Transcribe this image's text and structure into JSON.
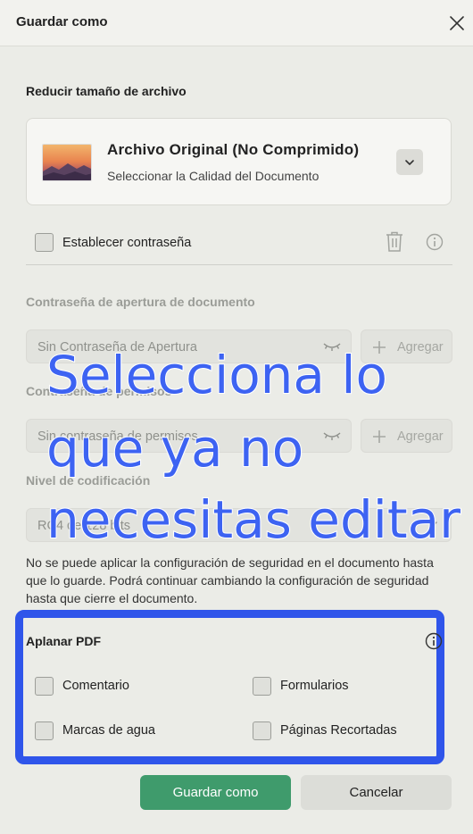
{
  "dialog": {
    "title": "Guardar como"
  },
  "reduce": {
    "label": "Reducir tamaño de archivo",
    "card_title": "Archivo Original (No Comprimido)",
    "card_subtitle": "Seleccionar la Calidad del Documento"
  },
  "password": {
    "set_label": "Establecer contraseña",
    "set_checked": false
  },
  "open_password": {
    "label": "Contraseña de apertura de documento",
    "value": "Sin Contraseña de Apertura",
    "add_label": "Agregar"
  },
  "permissions_password": {
    "label": "Contraseña de permisos",
    "value": "Sin contraseña de permisos",
    "add_label": "Agregar"
  },
  "encryption": {
    "label": "Nivel de codificación",
    "value": "RC4 de 128 bits"
  },
  "notice": "No se puede aplicar la configuración de seguridad en el documento hasta que lo guarde. Podrá continuar cambiando la configuración de seguridad hasta que cierre el documento.",
  "flatten": {
    "label": "Aplanar PDF",
    "options": [
      {
        "label": "Comentario",
        "checked": false
      },
      {
        "label": "Formularios",
        "checked": false
      },
      {
        "label": "Marcas de agua",
        "checked": false
      },
      {
        "label": "Páginas Recortadas",
        "checked": false
      }
    ]
  },
  "overlay": {
    "lines": [
      "Selecciona lo",
      "que ya no",
      "necesitas editar"
    ]
  },
  "footer": {
    "save_label": "Guardar como",
    "cancel_label": "Cancelar"
  },
  "colors": {
    "accent_green": "#3f9b6c",
    "highlight_blue": "#2f55ea",
    "caption_blue": "#3d63f2"
  }
}
